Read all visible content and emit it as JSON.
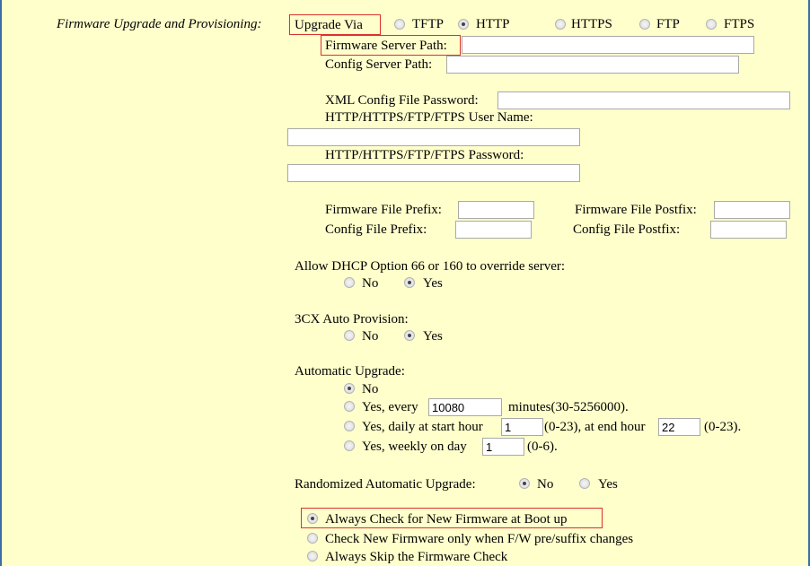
{
  "section_label": "Firmware Upgrade and Provisioning:",
  "upgrade_via": {
    "label": "Upgrade Via",
    "options": [
      "TFTP",
      "HTTP",
      "HTTPS",
      "FTP",
      "FTPS"
    ],
    "selected": "HTTP"
  },
  "paths": {
    "firmware_server_label": "Firmware Server Path:",
    "firmware_server_value": "",
    "config_server_label": "Config Server Path:",
    "config_server_value": ""
  },
  "credentials": {
    "xml_password_label": "XML Config File Password:",
    "xml_password_value": "",
    "username_label": "HTTP/HTTPS/FTP/FTPS User Name:",
    "username_value": "",
    "password_label": "HTTP/HTTPS/FTP/FTPS Password:",
    "password_value": ""
  },
  "file_naming": {
    "fw_prefix_label": "Firmware File Prefix:",
    "fw_postfix_label": "Firmware File Postfix:",
    "cfg_prefix_label": "Config File Prefix:",
    "cfg_postfix_label": "Config File Postfix:"
  },
  "dhcp_override": {
    "label": "Allow DHCP Option 66 or 160 to override server:",
    "no": "No",
    "yes": "Yes",
    "selected": "Yes"
  },
  "auto_provision": {
    "label": "3CX Auto Provision:",
    "no": "No",
    "yes": "Yes",
    "selected": "Yes"
  },
  "automatic_upgrade": {
    "label": "Automatic Upgrade:",
    "no_label": "No",
    "every_label": "Yes, every",
    "every_value": "10080",
    "every_suffix": "minutes(30-5256000).",
    "daily_label": "Yes, daily at start hour",
    "daily_start_value": "1",
    "daily_mid": "(0-23), at end hour",
    "daily_end_value": "22",
    "daily_suffix": "(0-23).",
    "weekly_label": "Yes, weekly on day",
    "weekly_value": "1",
    "weekly_suffix": "(0-6).",
    "selected": "No"
  },
  "randomized": {
    "label": "Randomized Automatic Upgrade:",
    "no": "No",
    "yes": "Yes",
    "selected": "No"
  },
  "firmware_check": {
    "options": [
      "Always Check for New Firmware at Boot up",
      "Check New Firmware only when F/W pre/suffix changes",
      "Always Skip the Firmware Check"
    ],
    "selected_index": 0
  },
  "colors": {
    "background": "#ffffcc",
    "highlight_border": "#d9322f",
    "frame": "#3c6ea8"
  }
}
